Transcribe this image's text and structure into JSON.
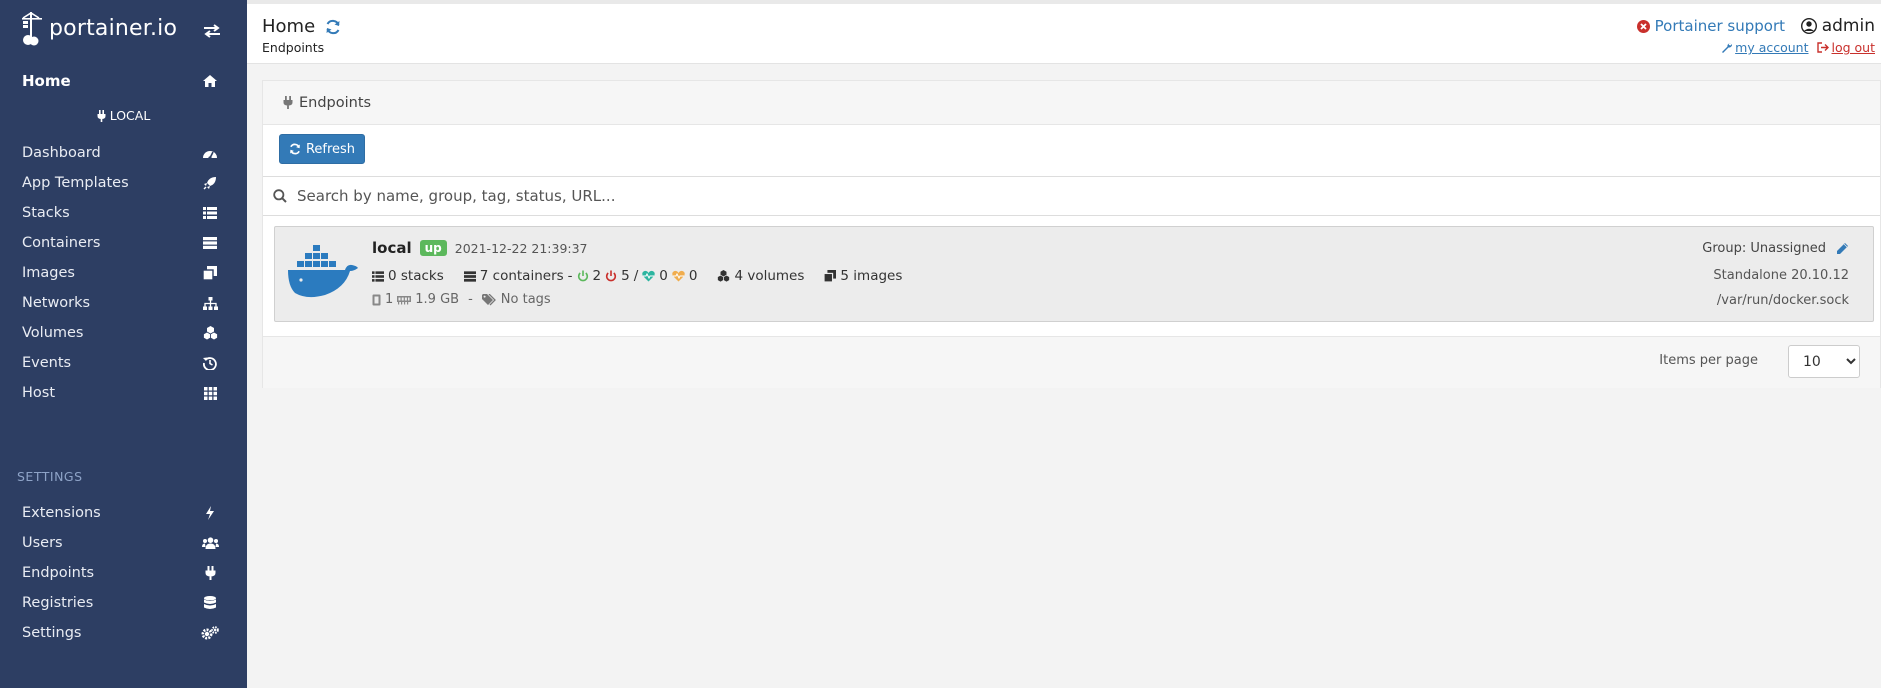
{
  "brand": {
    "name": "portainer.io"
  },
  "sidebar": {
    "home": "Home",
    "endpoint_name": "LOCAL",
    "items": [
      {
        "label": "Dashboard",
        "icon": "tachometer-icon"
      },
      {
        "label": "App Templates",
        "icon": "rocket-icon"
      },
      {
        "label": "Stacks",
        "icon": "th-list-icon"
      },
      {
        "label": "Containers",
        "icon": "server-icon"
      },
      {
        "label": "Images",
        "icon": "clone-icon"
      },
      {
        "label": "Networks",
        "icon": "sitemap-icon"
      },
      {
        "label": "Volumes",
        "icon": "cubes-icon"
      },
      {
        "label": "Events",
        "icon": "history-icon"
      },
      {
        "label": "Host",
        "icon": "th-icon"
      }
    ],
    "settings_title": "SETTINGS",
    "settings_items": [
      {
        "label": "Extensions",
        "icon": "bolt-icon"
      },
      {
        "label": "Users",
        "icon": "users-icon"
      },
      {
        "label": "Endpoints",
        "icon": "plug-icon"
      },
      {
        "label": "Registries",
        "icon": "database-icon"
      },
      {
        "label": "Settings",
        "icon": "cogs-icon"
      }
    ]
  },
  "header": {
    "title": "Home",
    "breadcrumb": "Endpoints",
    "support": "Portainer support",
    "user": "admin",
    "my_account": "my account",
    "log_out": "log out"
  },
  "widget": {
    "title": "Endpoints",
    "refresh": "Refresh",
    "search_placeholder": "Search by name, group, tag, status, URL...",
    "endpoint": {
      "name": "local",
      "status": "up",
      "timestamp": "2021-12-22 21:39:37",
      "stacks": "0 stacks",
      "containers": "7 containers",
      "dash": "-",
      "running": "2",
      "stopped": "5",
      "slash": "/",
      "healthy": "0",
      "unhealthy": "0",
      "volumes": "4 volumes",
      "images": "5 images",
      "cpu": "1",
      "memory": "1.9 GB",
      "sep": "-",
      "tags": "No tags",
      "group": "Group: Unassigned",
      "engine": "Standalone 20.10.12",
      "url": "/var/run/docker.sock"
    },
    "items_per_page_label": "Items per page",
    "items_per_page": "10"
  },
  "colors": {
    "sidebar": "#2d3e63",
    "primary": "#337ab7",
    "up": "#5cb85c",
    "danger": "#c9302c"
  }
}
